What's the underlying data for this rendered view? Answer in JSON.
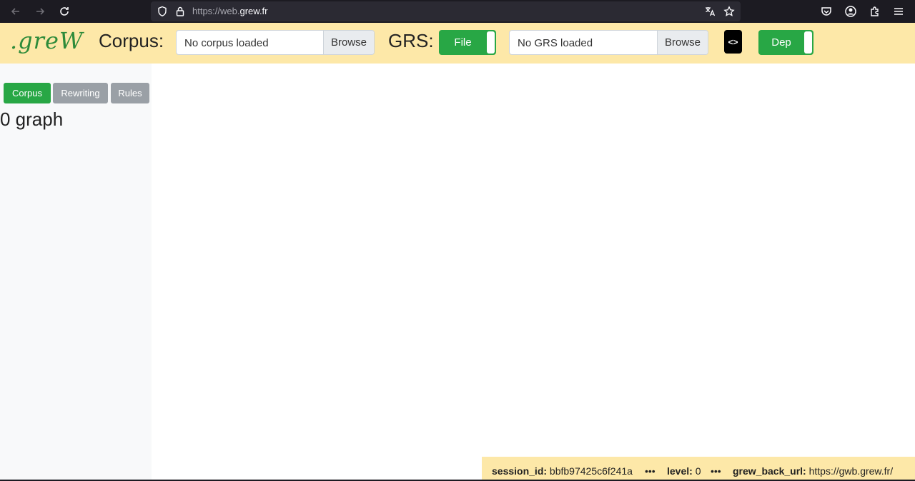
{
  "browser": {
    "url_prefix": "https://web.",
    "url_domain": "grew.fr",
    "icons": [
      "back-arrow-icon",
      "forward-arrow-icon",
      "reload-icon",
      "shield-icon",
      "lock-icon",
      "translate-icon",
      "star-icon",
      "pocket-icon",
      "account-icon",
      "extensions-icon",
      "menu-icon"
    ]
  },
  "header": {
    "logo": ".greW",
    "corpus_label": "Corpus:",
    "corpus_value": "No corpus loaded",
    "corpus_browse": "Browse",
    "grs_label": "GRS:",
    "grs_toggle": "File",
    "grs_value": "No GRS loaded",
    "grs_browse": "Browse",
    "code_icon_text": "<>",
    "dep_toggle": "Dep"
  },
  "sidebar": {
    "tabs": [
      {
        "label": "Corpus",
        "active": true
      },
      {
        "label": "Rewriting",
        "active": false
      },
      {
        "label": "Rules",
        "active": false
      }
    ],
    "graph_count": "0 graph"
  },
  "status": {
    "session_key": "session_id:",
    "session_value": "bbfb97425c6f241a",
    "level_key": "level:",
    "level_value": "0",
    "url_key": "grew_back_url:",
    "url_value": "https://gwb.grew.fr/",
    "separator": "•••"
  },
  "colors": {
    "header_bg": "#fde8a8",
    "toggle_green": "#28a745",
    "inactive_tab": "#9aa0a6",
    "browser_dark": "#1c1b22"
  }
}
